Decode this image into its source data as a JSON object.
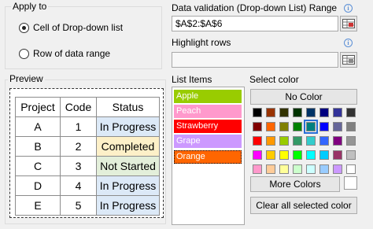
{
  "apply_to": {
    "title": "Apply to",
    "options": [
      {
        "label": "Cell of Drop-down list",
        "checked": true
      },
      {
        "label": "Row of data range",
        "checked": false
      }
    ]
  },
  "data_validation": {
    "label": "Data validation (Drop-down List) Range",
    "value": "$A$2:$A$6",
    "icon": "info-icon"
  },
  "highlight_rows": {
    "label": "Highlight rows",
    "value": "",
    "icon": "info-icon"
  },
  "preview": {
    "title": "Preview",
    "headers": [
      "Project",
      "Code",
      "Status"
    ],
    "rows": [
      {
        "project": "A",
        "code": "1",
        "status": "In Progress",
        "color": "#dce9f7"
      },
      {
        "project": "B",
        "code": "2",
        "status": "Completed",
        "color": "#fdf0c8"
      },
      {
        "project": "C",
        "code": "3",
        "status": "Not Started",
        "color": "#e3efda"
      },
      {
        "project": "D",
        "code": "4",
        "status": "In Progress",
        "color": "#dce9f7"
      },
      {
        "project": "E",
        "code": "5",
        "status": "In Progress",
        "color": "#dce9f7"
      }
    ]
  },
  "list_items": {
    "title": "List Items",
    "items": [
      {
        "label": "Apple",
        "color": "#99cc00"
      },
      {
        "label": "Peach",
        "color": "#ff99cc"
      },
      {
        "label": "Strawberry",
        "color": "#ff0000"
      },
      {
        "label": "Grape",
        "color": "#cc99ff"
      },
      {
        "label": "Orange",
        "color": "#ff6600"
      }
    ]
  },
  "select_color": {
    "title": "Select color",
    "no_color_label": "No Color",
    "more_colors_label": "More Colors",
    "clear_label": "Clear all selected color",
    "selected_index": 12,
    "palette": [
      "#000000",
      "#993300",
      "#333300",
      "#003300",
      "#003366",
      "#000080",
      "#333399",
      "#333333",
      "#800000",
      "#ff6600",
      "#808000",
      "#008000",
      "#008080",
      "#0000ff",
      "#666699",
      "#808080",
      "#ff0000",
      "#ff9900",
      "#99cc00",
      "#339966",
      "#33cccc",
      "#3366ff",
      "#800080",
      "#969696",
      "#ff00ff",
      "#ffcc00",
      "#ffff00",
      "#00ff00",
      "#00ffff",
      "#00ccff",
      "#993366",
      "#c0c0c0",
      "#ff99cc",
      "#ffcc99",
      "#ffff99",
      "#ccffcc",
      "#ccffff",
      "#99ccff",
      "#cc99ff",
      "#ffffff"
    ]
  }
}
